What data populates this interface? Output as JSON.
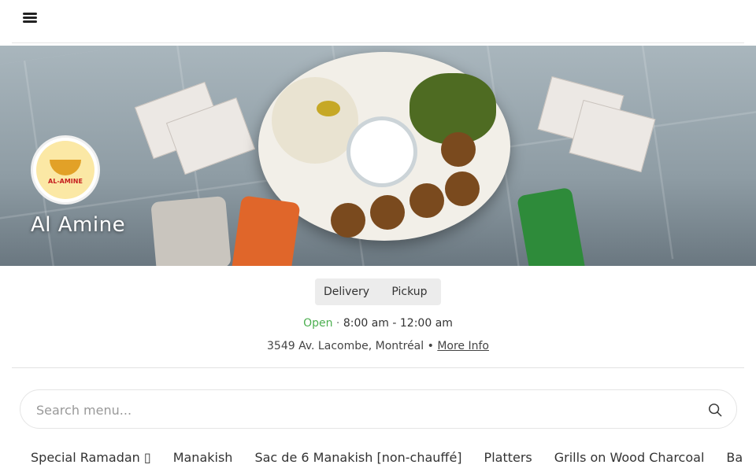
{
  "header": {
    "menu_icon": "hamburger-menu-icon"
  },
  "restaurant": {
    "name": "Al Amine",
    "logo_text": "AL-AMINE"
  },
  "order_modes": {
    "delivery_label": "Delivery",
    "pickup_label": "Pickup"
  },
  "hours": {
    "status": "Open",
    "separator": " · ",
    "time_range": "8:00 am - 12:00 am"
  },
  "location": {
    "address": "3549 Av. Lacombe, Montréal",
    "bullet": " • ",
    "more_info_label": "More Info"
  },
  "search": {
    "placeholder": "Search menu...",
    "value": "",
    "icon": "search-icon"
  },
  "categories": [
    "Special Ramadan ▯",
    "Manakish",
    "Sac de 6 Manakish [non-chauffé]",
    "Platters",
    "Grills on Wood Charcoal",
    "Ba"
  ],
  "colors": {
    "open_status": "#4caf50",
    "toggle_bg": "#ececec"
  }
}
